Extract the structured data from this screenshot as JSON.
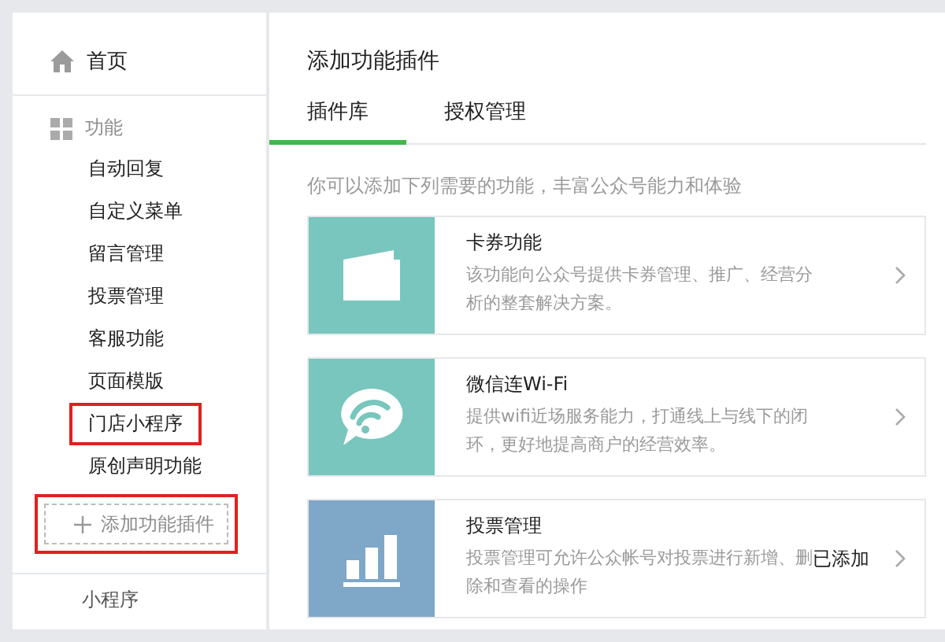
{
  "sidebar": {
    "home": {
      "label": "首页"
    },
    "section": {
      "label": "功能"
    },
    "items": [
      {
        "label": "自动回复",
        "highlighted": false
      },
      {
        "label": "自定义菜单",
        "highlighted": false
      },
      {
        "label": "留言管理",
        "highlighted": false
      },
      {
        "label": "投票管理",
        "highlighted": false
      },
      {
        "label": "客服功能",
        "highlighted": false
      },
      {
        "label": "页面模版",
        "highlighted": false
      },
      {
        "label": "门店小程序",
        "highlighted": true
      },
      {
        "label": "原创声明功能",
        "highlighted": false
      }
    ],
    "add_button": {
      "label": "添加功能插件",
      "highlighted": true
    },
    "next_section": {
      "label": "小程序"
    }
  },
  "main": {
    "title": "添加功能插件",
    "tabs": [
      {
        "label": "插件库",
        "selected": true
      },
      {
        "label": "授权管理",
        "selected": false
      }
    ],
    "intro": "你可以添加下列需要的功能，丰富公众号能力和体验",
    "plugins": [
      {
        "kind": "card",
        "color": "#78c6bd",
        "title": "卡券功能",
        "description": "该功能向公众号提供卡券管理、推广、经营分析的整套解决方案。"
      },
      {
        "kind": "wifi",
        "color": "#78c6bd",
        "title": "微信连Wi-Fi",
        "description": "提供wifi近场服务能力，打通线上与线下的闭环，更好地提高商户的经营效率。"
      },
      {
        "kind": "vote",
        "color": "#7ea7c8",
        "title": "投票管理",
        "description": "投票管理可允许公众帐号对投票进行新增、删除和查看的操作",
        "status": "已添加"
      }
    ]
  }
}
